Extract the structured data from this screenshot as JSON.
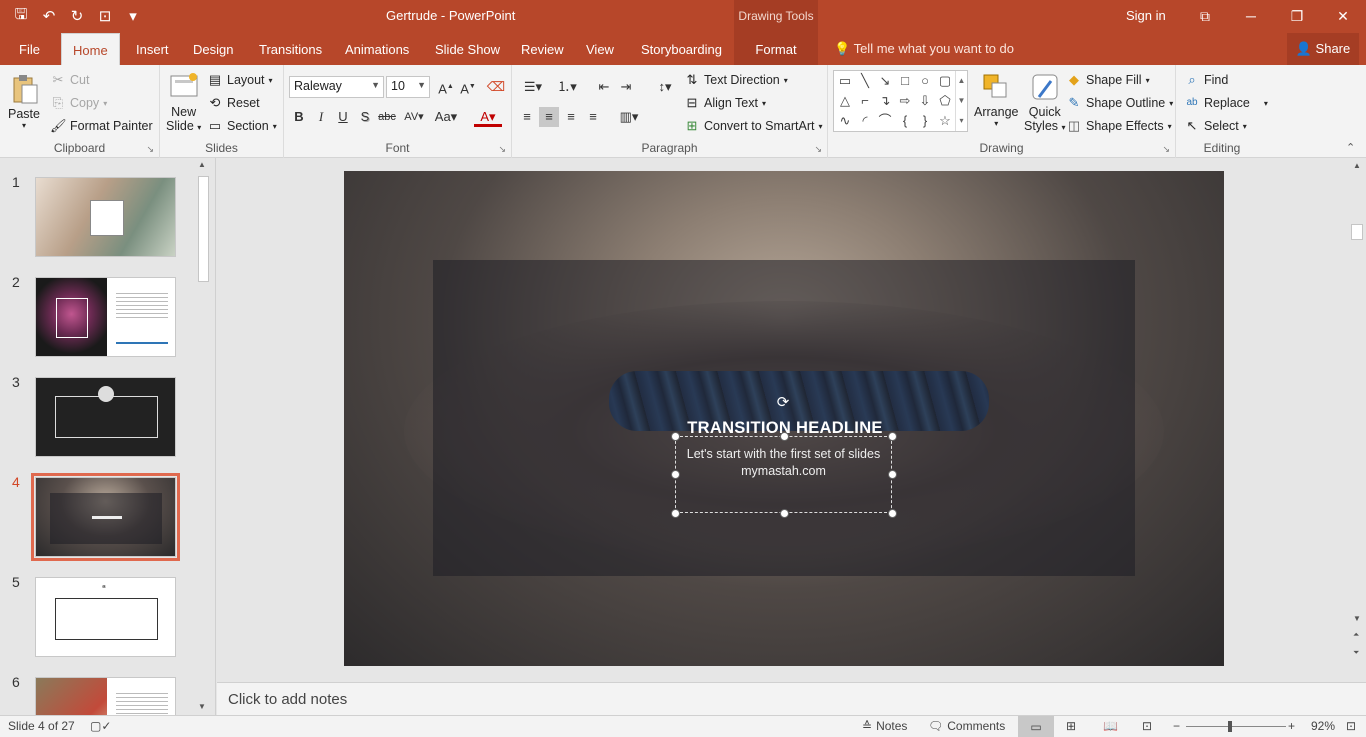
{
  "titlebar": {
    "doc_title": "Gertrude  -  PowerPoint",
    "context_tools": "Drawing Tools",
    "signin": "Sign in"
  },
  "tabs": [
    "File",
    "Home",
    "Insert",
    "Design",
    "Transitions",
    "Animations",
    "Slide Show",
    "Review",
    "View",
    "Storyboarding",
    "Format"
  ],
  "active_tab": "Home",
  "tellme": "Tell me what you want to do",
  "share": "Share",
  "ribbon": {
    "clipboard": {
      "paste": "Paste",
      "cut": "Cut",
      "copy": "Copy",
      "format_painter": "Format Painter",
      "label": "Clipboard"
    },
    "slides": {
      "new_slide_1": "New",
      "new_slide_2": "Slide",
      "layout": "Layout",
      "reset": "Reset",
      "section": "Section",
      "label": "Slides"
    },
    "font": {
      "name": "Raleway",
      "size": "10",
      "label": "Font"
    },
    "paragraph": {
      "text_direction": "Text Direction",
      "align_text": "Align Text",
      "convert_smartart": "Convert to SmartArt",
      "label": "Paragraph"
    },
    "drawing": {
      "arrange": "Arrange",
      "quick_styles_1": "Quick",
      "quick_styles_2": "Styles",
      "shape_fill": "Shape Fill",
      "shape_outline": "Shape Outline",
      "shape_effects": "Shape Effects",
      "label": "Drawing"
    },
    "editing": {
      "find": "Find",
      "replace": "Replace",
      "select": "Select",
      "label": "Editing"
    }
  },
  "slides": {
    "numbers": [
      "1",
      "2",
      "3",
      "4",
      "5",
      "6"
    ],
    "active": "4"
  },
  "slide": {
    "headline": "TRANSITION HEADLINE",
    "subtext": "Let's start with the first set of slides mymastah.com"
  },
  "notes_placeholder": "Click to add notes",
  "status": {
    "slide_count": "Slide 4 of 27",
    "notes": "Notes",
    "comments": "Comments",
    "zoom": "92%"
  },
  "colors": {
    "accent": "#b7472a",
    "ribbon_bg": "#f3f3f3",
    "active_thumb": "#e0694e"
  }
}
